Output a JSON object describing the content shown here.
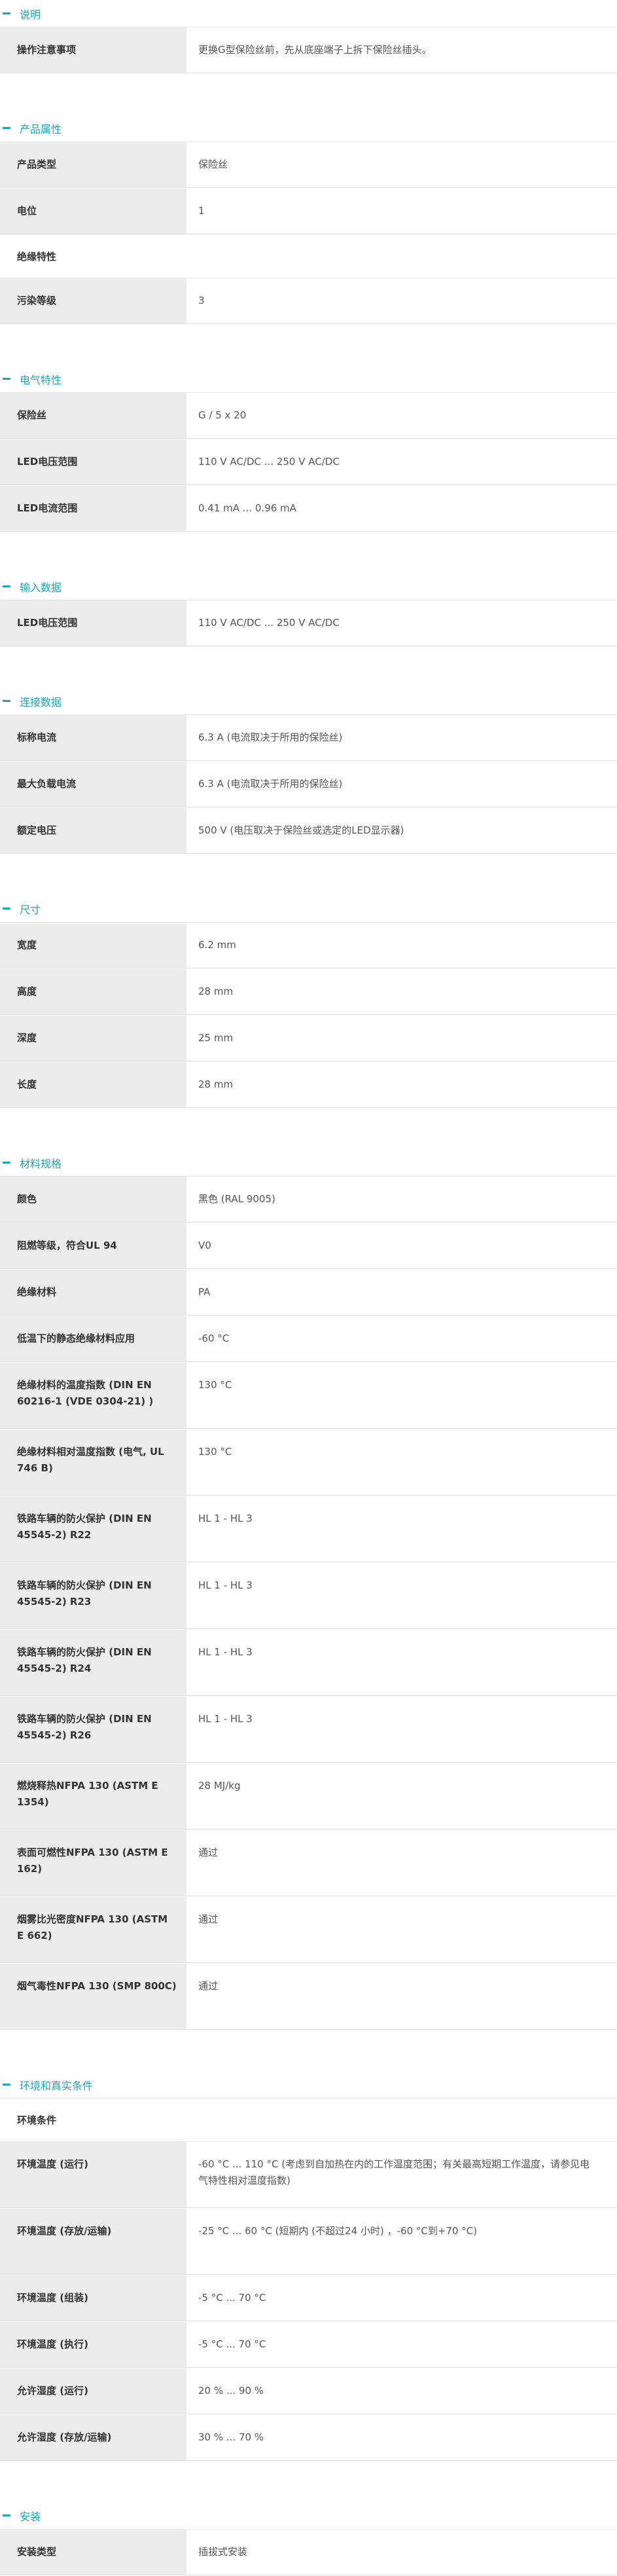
{
  "sections": [
    {
      "title": "说明",
      "rows": [
        {
          "label": "操作注意事项",
          "value": "更换G型保险丝前，先从底座端子上拆下保险丝插头。"
        }
      ]
    },
    {
      "title": "产品属性",
      "rows": [
        {
          "label": "产品类型",
          "value": "保险丝"
        },
        {
          "label": "电位",
          "value": "1"
        }
      ],
      "subheading": "绝缘特性",
      "rows2": [
        {
          "label": "污染等级",
          "value": "3"
        }
      ]
    },
    {
      "title": "电气特性",
      "rows": [
        {
          "label": "保险丝",
          "value": "G / 5 x 20"
        },
        {
          "label": "LED电压范围",
          "value": "110 V AC/DC ... 250 V AC/DC"
        },
        {
          "label": "LED电流范围",
          "value": "0.41 mA ... 0.96 mA"
        }
      ]
    },
    {
      "title": "输入数据",
      "rows": [
        {
          "label": "LED电压范围",
          "value": "110 V AC/DC ... 250 V AC/DC"
        }
      ]
    },
    {
      "title": "连接数据",
      "rows": [
        {
          "label": "标称电流",
          "value": "6.3 A (电流取决于所用的保险丝)"
        },
        {
          "label": "最大负载电流",
          "value": "6.3 A (电流取决于所用的保险丝)"
        },
        {
          "label": "额定电压",
          "value": "500 V (电压取决于保险丝或选定的LED显示器)"
        }
      ]
    },
    {
      "title": "尺寸",
      "rows": [
        {
          "label": "宽度",
          "value": "6.2 mm"
        },
        {
          "label": "高度",
          "value": "28 mm"
        },
        {
          "label": "深度",
          "value": "25 mm"
        },
        {
          "label": "长度",
          "value": "28 mm"
        }
      ]
    },
    {
      "title": "材料规格",
      "rows": [
        {
          "label": "颜色",
          "value": "黑色 (RAL 9005)"
        },
        {
          "label": "阻燃等级，符合UL 94",
          "value": "V0"
        },
        {
          "label": "绝缘材料",
          "value": "PA"
        },
        {
          "label": "低温下的静态绝缘材料应用",
          "value": "-60 °C"
        },
        {
          "label": "绝缘材料的温度指数 (DIN EN 60216-1 (VDE 0304-21) )",
          "value": "130 °C"
        },
        {
          "label": "绝缘材料相对温度指数 (电气, UL 746 B)",
          "value": "130 °C"
        },
        {
          "label": "铁路车辆的防火保护 (DIN EN 45545-2) R22",
          "value": "HL 1 - HL 3"
        },
        {
          "label": "铁路车辆的防火保护 (DIN EN 45545-2) R23",
          "value": "HL 1 - HL 3"
        },
        {
          "label": "铁路车辆的防火保护 (DIN EN 45545-2) R24",
          "value": "HL 1 - HL 3"
        },
        {
          "label": "铁路车辆的防火保护 (DIN EN 45545-2) R26",
          "value": "HL 1 - HL 3"
        },
        {
          "label": "燃烧释热NFPA 130 (ASTM E 1354)",
          "value": "28 MJ/kg"
        },
        {
          "label": "表面可燃性NFPA 130 (ASTM E 162)",
          "value": "通过"
        },
        {
          "label": "烟雾比光密度NFPA 130 (ASTM E 662)",
          "value": "通过"
        },
        {
          "label": "烟气毒性NFPA 130 (SMP 800C)",
          "value": "通过"
        }
      ]
    },
    {
      "title": "环境和真实条件",
      "subheading": "环境条件",
      "rows": [
        {
          "label": "环境温度 (运行)",
          "value": "-60 °C ... 110 °C (考虑到自加热在内的工作温度范围；有关最高短期工作温度，请参见电气特性相对温度指数)"
        },
        {
          "label": "环境温度 (存放/运输)",
          "value": "-25 °C ... 60 °C (短期内 (不超过24 小时) ，-60 °C到+70 °C)"
        },
        {
          "label": "环境温度 (组装)",
          "value": "-5 °C ... 70 °C"
        },
        {
          "label": "环境温度 (执行)",
          "value": "-5 °C ... 70 °C"
        },
        {
          "label": "允许湿度 (运行)",
          "value": "20 % ... 90 %"
        },
        {
          "label": "允许湿度 (存放/运输)",
          "value": "30 % ... 70 %"
        }
      ]
    },
    {
      "title": "安装",
      "rows": [
        {
          "label": "安装类型",
          "value": "插拔式安装"
        }
      ]
    }
  ]
}
